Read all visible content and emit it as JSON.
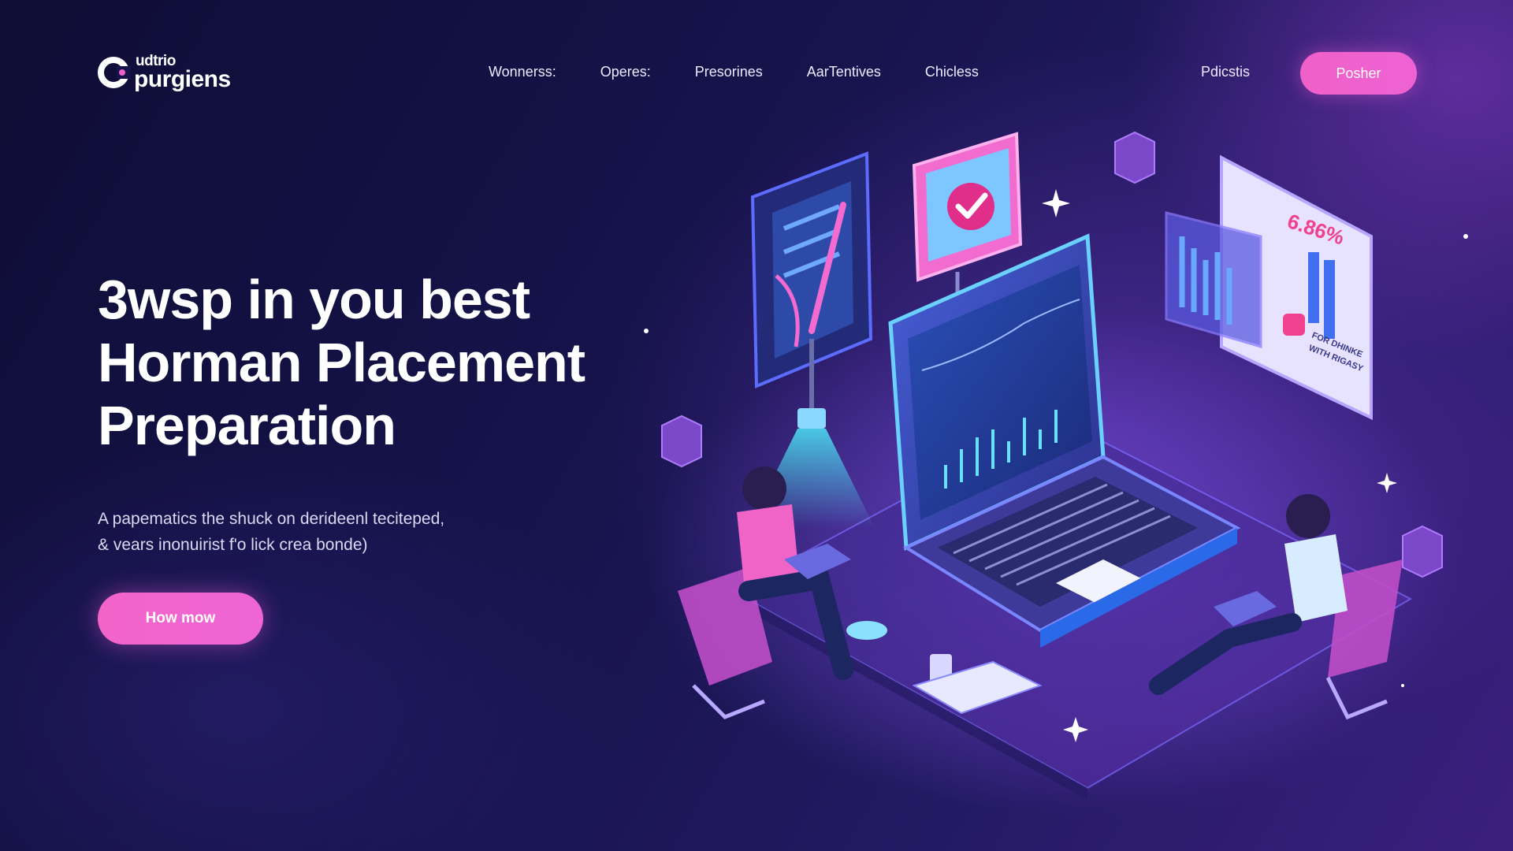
{
  "brand": {
    "logo_top": "udtrio",
    "logo_bottom": "purgiens",
    "accent": "#f060c8",
    "background": "#15134a"
  },
  "nav": {
    "items": [
      {
        "label": "Wonnerss:"
      },
      {
        "label": "Operes:"
      },
      {
        "label": "Presorines"
      },
      {
        "label": "AarTentives"
      },
      {
        "label": "Chicless"
      }
    ],
    "right_link": "Pdicstis",
    "cta_label": "Posher"
  },
  "hero": {
    "title_line1": "3wsp in you best",
    "title_line2": "Horman Placement",
    "title_line3": "Preparation",
    "subtitle_line1": "A papematics the shuck on derideenl teciteped,",
    "subtitle_line2": "& vears inonuirist f'o lick crea bonde)",
    "cta_label": "How mow"
  },
  "illustration": {
    "stat_value": "6.86%",
    "stat_caption_line1": "FOR DHINKE",
    "stat_caption_line2": "WITH RIGASY",
    "icons": [
      "checkmark-icon",
      "laptop-icon",
      "bar-chart-icon",
      "lamp-icon",
      "server-cube-icon",
      "sparkle-icon"
    ]
  }
}
